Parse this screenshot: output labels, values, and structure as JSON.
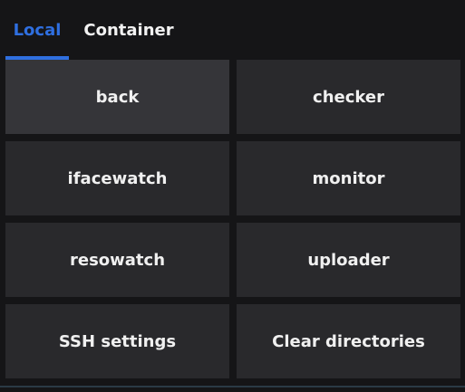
{
  "tabs": {
    "local": "Local",
    "container": "Container",
    "active": "Local"
  },
  "buttons": [
    "back",
    "checker",
    "ifacewatch",
    "monitor",
    "resowatch",
    "uploader",
    "SSH settings",
    "Clear directories"
  ],
  "colors": {
    "accent": "#2f6fe0",
    "background": "#151517",
    "button": "#29292c",
    "button_hover": "#353539",
    "text": "#f0f0f0"
  }
}
